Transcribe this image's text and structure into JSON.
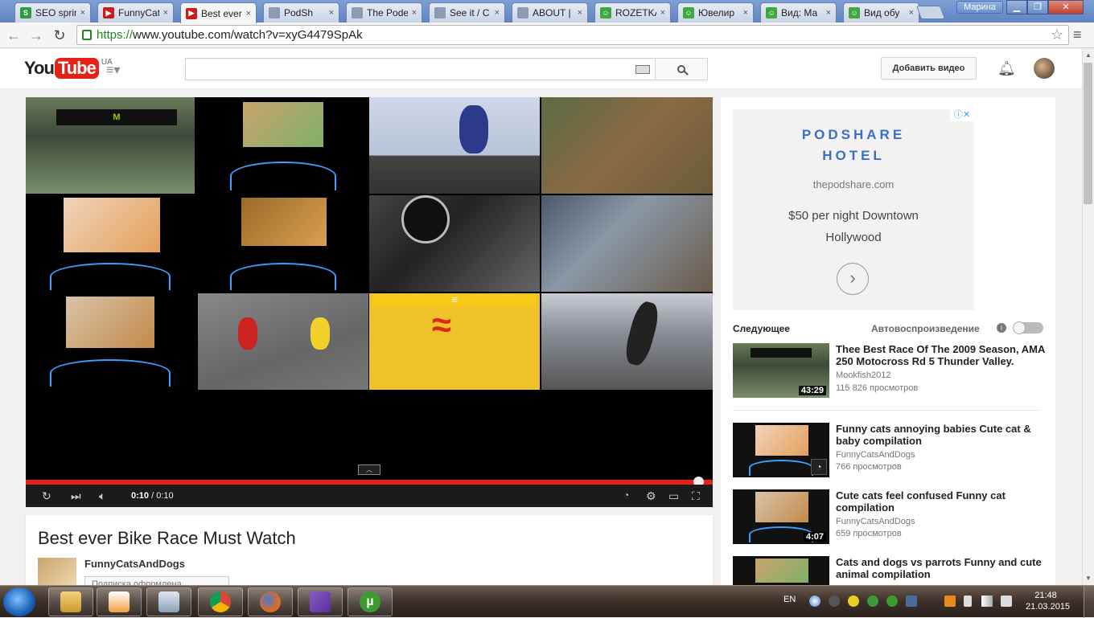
{
  "browser": {
    "tabs": [
      {
        "label": "SEO sprint",
        "fav_color": "#2e9b3e",
        "fav_glyph": "S"
      },
      {
        "label": "FunnyCats",
        "fav_color": "#cc1b1b",
        "fav_glyph": "▶"
      },
      {
        "label": "Best ever",
        "fav_color": "#cc1b1b",
        "fav_glyph": "▶"
      },
      {
        "label": "PodSh",
        "fav_color": "#8a9bb5",
        "fav_glyph": ""
      },
      {
        "label": "The Pode",
        "fav_color": "#8a9bb5",
        "fav_glyph": ""
      },
      {
        "label": "See it / C",
        "fav_color": "#8a9bb5",
        "fav_glyph": ""
      },
      {
        "label": "ABOUT |",
        "fav_color": "#8a9bb5",
        "fav_glyph": ""
      },
      {
        "label": "ROZETKA",
        "fav_color": "#3fa73f",
        "fav_glyph": "☺"
      },
      {
        "label": "Ювелир",
        "fav_color": "#3fa73f",
        "fav_glyph": "☺"
      },
      {
        "label": "Вид: Ма",
        "fav_color": "#3fa73f",
        "fav_glyph": "☺"
      },
      {
        "label": "Вид обу",
        "fav_color": "#3fa73f",
        "fav_glyph": "☺"
      }
    ],
    "active_tab": 2,
    "user": "Марина",
    "url_scheme": "https://",
    "url_rest": "www.youtube.com/watch?v=xyG4479SpAk"
  },
  "youtube": {
    "logo_you": "You",
    "logo_tube": "Tube",
    "region": "UA",
    "search_placeholder": "",
    "upload_label": "Добавить видео",
    "player": {
      "time_current": "0:10",
      "time_total": "/ 0:10",
      "progress": 1.0
    },
    "video": {
      "title": "Best ever Bike Race Must Watch",
      "channel": "FunnyCatsAndDogs",
      "subscribe_label": "Подписка оформлена"
    },
    "ad": {
      "brand_line1": "PODSHARE",
      "brand_line2": "HOTEL",
      "domain": "thepodshare.com",
      "line1": "$50 per night Downtown",
      "line2": "Hollywood",
      "adchoices": "ⓘ✕"
    },
    "up_next_label": "Следующее",
    "autoplay_label": "Автовоспроизведение",
    "recommendations": [
      {
        "title": "Thee Best Race Of The 2009 Season, AMA 250 Motocross Rd 5 Thunder Valley.",
        "channel": "Mookfish2012",
        "views": "115 826 просмотров",
        "duration": "43:29"
      },
      {
        "title": "Funny cats annoying babies Cute cat & baby compilation",
        "channel": "FunnyCatsAndDogs",
        "views": "766 просмотров",
        "duration": ""
      },
      {
        "title": "Cute cats feel confused Funny cat compilation",
        "channel": "FunnyCatsAndDogs",
        "views": "659 просмотров",
        "duration": "4:07"
      },
      {
        "title": "Cats and dogs vs parrots Funny and cute animal compilation",
        "channel": "",
        "views": "",
        "duration": ""
      }
    ]
  },
  "taskbar": {
    "lang": "EN",
    "time": "21:48",
    "date": "21.03.2015"
  }
}
